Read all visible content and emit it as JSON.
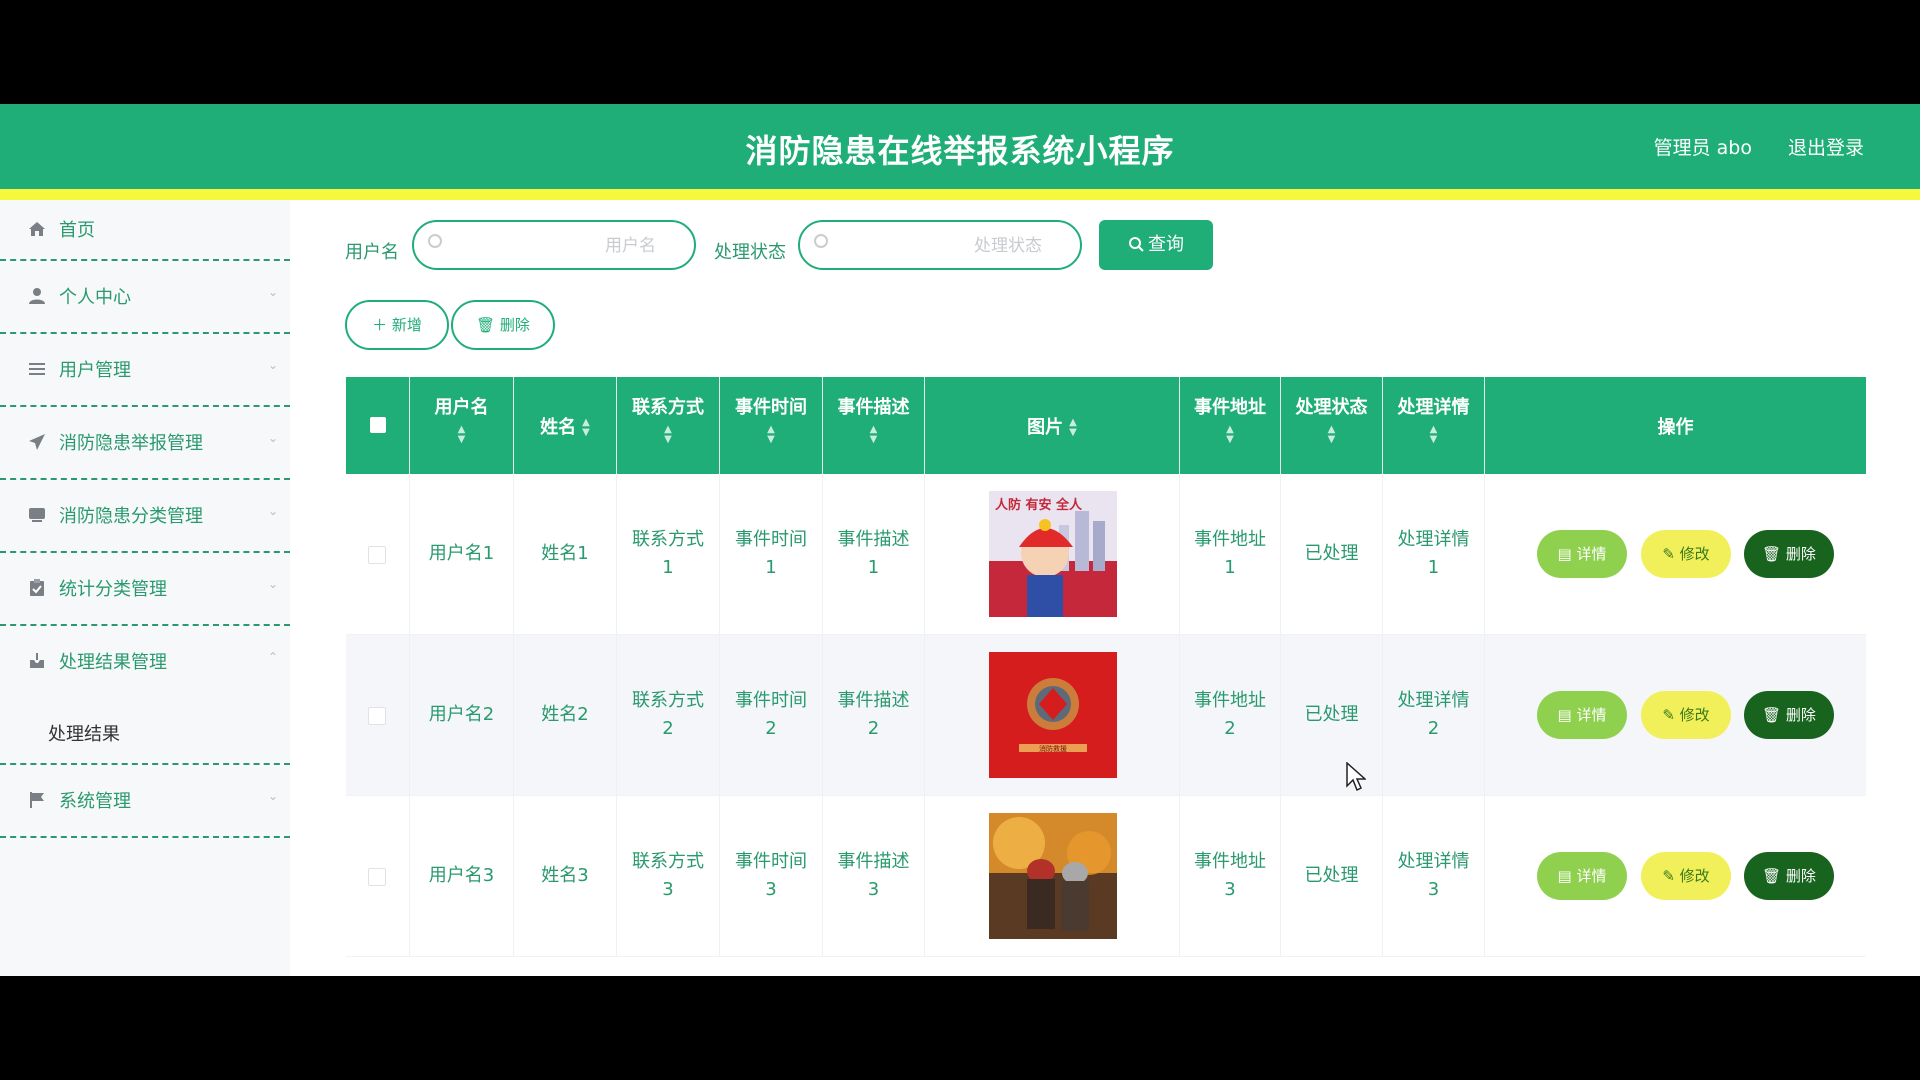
{
  "header": {
    "title": "消防隐患在线举报系统小程序",
    "user_label": "管理员 abo",
    "logout_label": "退出登录"
  },
  "sidebar": {
    "items": [
      {
        "label": "首页",
        "icon": "home-icon"
      },
      {
        "label": "个人中心",
        "icon": "user-icon"
      },
      {
        "label": "用户管理",
        "icon": "list-icon"
      },
      {
        "label": "消防隐患举报管理",
        "icon": "send-icon"
      },
      {
        "label": "消防隐患分类管理",
        "icon": "card-icon"
      },
      {
        "label": "统计分类管理",
        "icon": "clipboard-icon"
      },
      {
        "label": "处理结果管理",
        "icon": "inbox-icon"
      },
      {
        "label": "系统管理",
        "icon": "flag-icon"
      }
    ],
    "subitems": [
      {
        "label": "处理结果"
      }
    ]
  },
  "search": {
    "username_label": "用户名",
    "username_placeholder": "用户名",
    "status_label": "处理状态",
    "status_placeholder": "处理状态",
    "query_label": "查询"
  },
  "toolbar": {
    "add_label": "新增",
    "delete_label": "删除"
  },
  "table": {
    "columns": [
      "用户名",
      "姓名",
      "联系方式",
      "事件时间",
      "事件描述",
      "图片",
      "事件地址",
      "处理状态",
      "处理详情",
      "操作"
    ],
    "rows": [
      {
        "username": "用户名1",
        "name": "姓名1",
        "contact": [
          "联系方式",
          "1"
        ],
        "time": [
          "事件时间",
          "1"
        ],
        "desc": [
          "事件描述",
          "1"
        ],
        "address": [
          "事件地址",
          "1"
        ],
        "status": "已处理",
        "detail": [
          "处理详情",
          "1"
        ]
      },
      {
        "username": "用户名2",
        "name": "姓名2",
        "contact": [
          "联系方式",
          "2"
        ],
        "time": [
          "事件时间",
          "2"
        ],
        "desc": [
          "事件描述",
          "2"
        ],
        "address": [
          "事件地址",
          "2"
        ],
        "status": "已处理",
        "detail": [
          "处理详情",
          "2"
        ]
      },
      {
        "username": "用户名3",
        "name": "姓名3",
        "contact": [
          "联系方式",
          "3"
        ],
        "time": [
          "事件时间",
          "3"
        ],
        "desc": [
          "事件描述",
          "3"
        ],
        "address": [
          "事件地址",
          "3"
        ],
        "status": "已处理",
        "detail": [
          "处理详情",
          "3"
        ]
      }
    ],
    "actions": {
      "detail_label": "详情",
      "edit_label": "修改",
      "delete_label": "删除"
    },
    "images": [
      {
        "text": "人防 有安 全人"
      },
      {
        "text": "消防救援"
      },
      {
        "text": ""
      }
    ]
  },
  "colors": {
    "primary": "#1fad78",
    "accent_bar": "#f5f83c",
    "detail_btn": "#8fd14f",
    "edit_btn": "#f2f05a",
    "delete_btn": "#18641f"
  }
}
